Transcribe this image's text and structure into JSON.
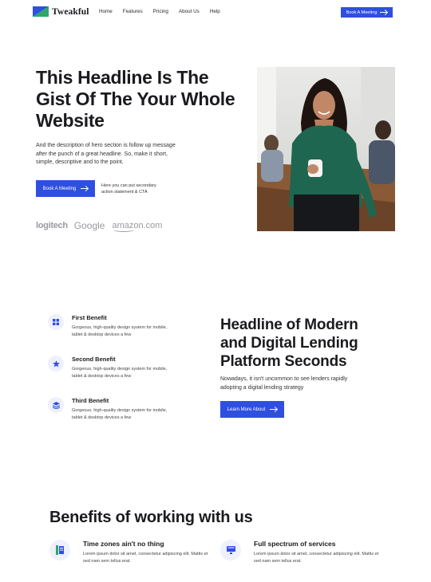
{
  "nav": {
    "brand": "Tweakful",
    "menu": [
      "Home",
      "Features",
      "Pricing",
      "About Us",
      "Help"
    ],
    "cta": "Book A Meeting"
  },
  "hero": {
    "title": "This Headline Is The Gist Of The Your Whole Website",
    "description": "And the description of hero section is follow up message after the punch of a great headline. So, make it short, simple, descriptive and to the point.",
    "cta": "Book A Meeting",
    "secondary": "Here you can put secondary action statement & CTA",
    "brands": {
      "logitech": "logitech",
      "google": "Google",
      "amazon": "amazon.com"
    }
  },
  "benefits": [
    {
      "title": "First Benefit",
      "text": "Gorgeous, high-quality design system for mobile, tablet & desktop devices a few",
      "icon": "grid-icon"
    },
    {
      "title": "Second Benefit",
      "text": "Gorgeous, high-quality design system for mobile, tablet & desktop devices a few",
      "icon": "star-icon"
    },
    {
      "title": "Third Benefit",
      "text": "Gorgeous, high-quality design system for mobile, tablet & desktop devices a few",
      "icon": "layers-icon"
    }
  ],
  "section2": {
    "title": "Headline of Modern and Digital Lending Platform Seconds",
    "description": "Nowadays, it isn't uncommon to see lenders rapidly adopting a digital lending strategy",
    "cta": "Learn More About"
  },
  "section3": {
    "title": "Benefits of working with us",
    "features": [
      {
        "title": "Time zones ain't no thing",
        "text": "Lorem ipsum dolor sit amet, consectetur adipiscing elit. Mattis et sed nam sem tellus erat.",
        "icon": "document-icon"
      },
      {
        "title": "Full spectrum of services",
        "text": "Lorem ipsum dolor sit amet, consectetur adipiscing elit. Mattis et sed nam sem tellus erat.",
        "icon": "monitor-icon"
      }
    ]
  },
  "colors": {
    "accent": "#2f4fe0",
    "iconBg": "#eef0fb"
  }
}
